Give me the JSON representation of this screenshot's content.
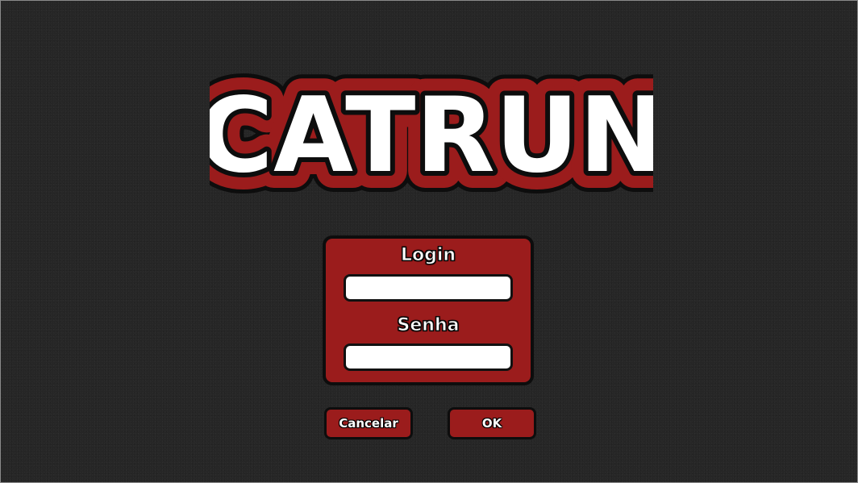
{
  "logo": {
    "text": "CATRUN",
    "fill_color": "#ffffff",
    "outline_color": "#9b1c1c",
    "edge_color": "#0d0d0d"
  },
  "login_form": {
    "login_label": "Login",
    "login_value": "",
    "password_label": "Senha",
    "password_value": ""
  },
  "buttons": {
    "cancel_label": "Cancelar",
    "ok_label": "OK"
  },
  "colors": {
    "panel": "#9b1c1c",
    "background": "#262626"
  }
}
